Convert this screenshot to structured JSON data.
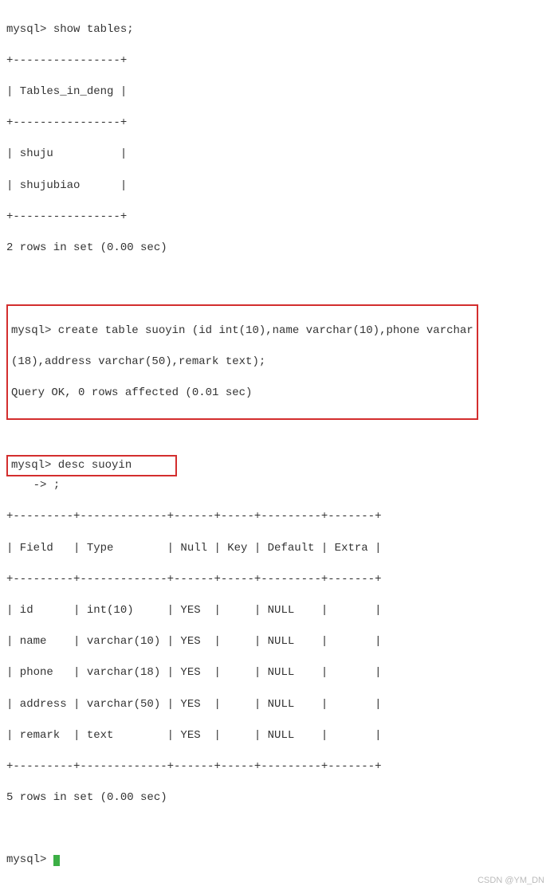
{
  "prompt": "mysql>",
  "cont_prompt": "    ->",
  "cmd_show_tables": " show tables;",
  "tables_border": "+----------------+",
  "tables_header": "| Tables_in_deng |",
  "tables_rows": [
    "| shuju          |",
    "| shujubiao      |"
  ],
  "tables_result": "2 rows in set (0.00 sec)",
  "cmd_create_line1": "mysql> create table suoyin (id int(10),name varchar(10),phone varchar",
  "cmd_create_line2": "(18),address varchar(50),remark text);",
  "create_result": "Query OK, 0 rows affected (0.01 sec)",
  "cmd_desc": "mysql> desc suoyin",
  "cmd_desc_cont": " ;",
  "desc_border": "+---------+-------------+------+-----+---------+-------+",
  "desc_header": "| Field   | Type        | Null | Key | Default | Extra |",
  "desc_rows": [
    "| id      | int(10)     | YES  |     | NULL    |       |",
    "| name    | varchar(10) | YES  |     | NULL    |       |",
    "| phone   | varchar(18) | YES  |     | NULL    |       |",
    "| address | varchar(50) | YES  |     | NULL    |       |",
    "| remark  | text        | YES  |     | NULL    |       |"
  ],
  "desc_result": "5 rows in set (0.00 sec)",
  "watermark": "CSDN @YM_DN"
}
